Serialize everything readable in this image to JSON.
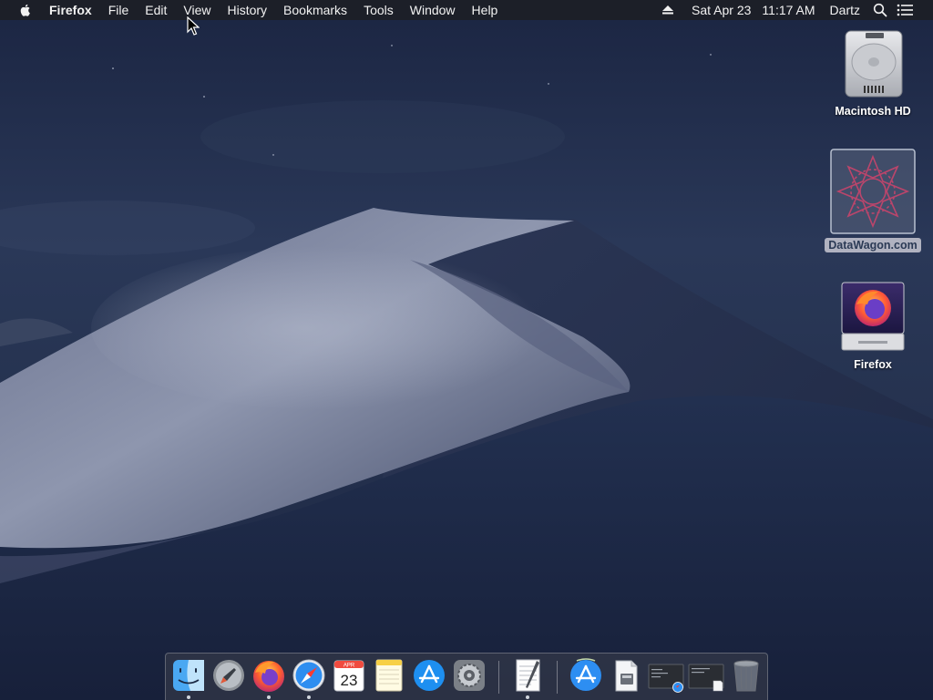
{
  "menubar": {
    "app_name": "Firefox",
    "menus": [
      "File",
      "Edit",
      "View",
      "History",
      "Bookmarks",
      "Tools",
      "Window",
      "Help"
    ],
    "date": "Sat Apr 23",
    "time": "11:17 AM",
    "user": "Dartz"
  },
  "desktop": {
    "icons": [
      {
        "label": "Macintosh HD",
        "icon": "hard-drive-icon"
      },
      {
        "label": "DataWagon.com",
        "icon": "datawagon-volume-icon",
        "selected": true
      },
      {
        "label": "Firefox",
        "icon": "firefox-disk-image-icon"
      }
    ]
  },
  "dock": {
    "items": [
      {
        "name": "Finder",
        "icon": "finder-icon",
        "running": true
      },
      {
        "name": "Launchpad",
        "icon": "launchpad-icon",
        "running": false
      },
      {
        "name": "Firefox",
        "icon": "firefox-icon",
        "running": true
      },
      {
        "name": "Safari",
        "icon": "safari-icon",
        "running": true
      },
      {
        "name": "Calendar",
        "icon": "calendar-icon",
        "running": false,
        "month": "APR",
        "day": "23"
      },
      {
        "name": "Notes",
        "icon": "notes-icon",
        "running": false
      },
      {
        "name": "App Store",
        "icon": "app-store-icon",
        "running": false
      },
      {
        "name": "System Preferences",
        "icon": "system-preferences-icon",
        "running": false
      },
      {
        "name": "TextEdit",
        "icon": "textedit-icon",
        "running": true
      },
      {
        "name": "Applications",
        "icon": "applications-folder-icon",
        "running": false
      },
      {
        "name": "Document",
        "icon": "document-stack-icon",
        "running": false
      },
      {
        "name": "Minimized Window 1",
        "icon": "minimized-window-icon",
        "running": false
      },
      {
        "name": "Minimized Window 2",
        "icon": "minimized-window-icon",
        "running": false
      },
      {
        "name": "Trash",
        "icon": "trash-icon",
        "running": false
      }
    ]
  },
  "colors": {
    "sky_top": "#1c2744",
    "sky_mid": "#2d3b5e",
    "dune_light": "#8b93ab",
    "dune_dark": "#1d2640",
    "menubar_bg": "#1c1e26"
  }
}
